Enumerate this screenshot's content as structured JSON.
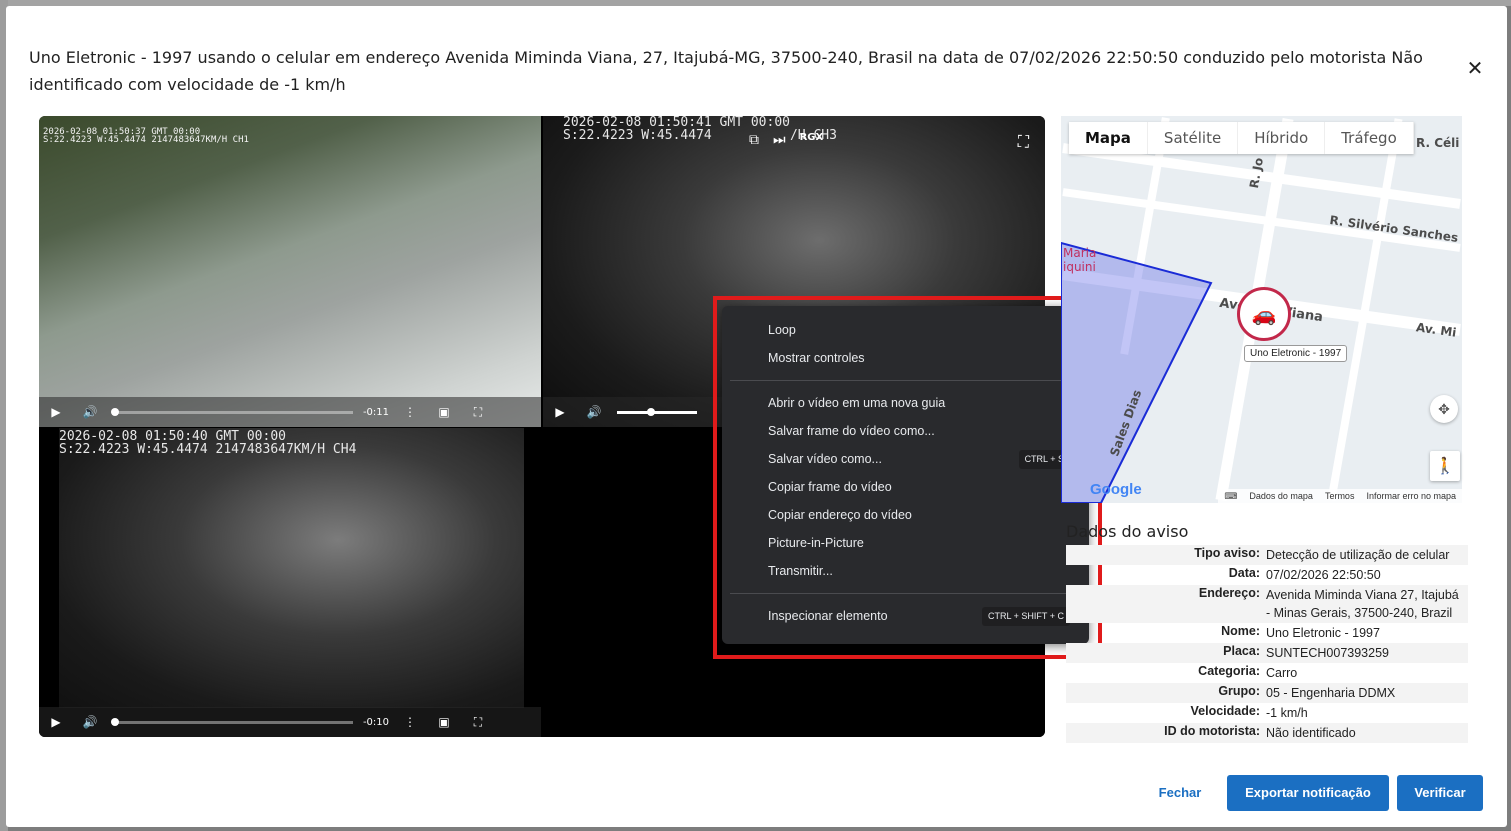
{
  "modal": {
    "title": "Uno Eletronic - 1997 usando o celular em endereço Avenida Miminda Viana, 27, Itajubá-MG, 37500-240, Brasil na data de 07/02/2026 22:50:50 conduzido pelo motorista Não identificado com velocidade de -1 km/h",
    "close": "✕"
  },
  "videos": {
    "cam1": {
      "osd": "2026-02-08 01:50:37 GMT 00:00\nS:22.4223 W:45.4474 2147483647KM/H CH1",
      "time": "-0:11",
      "progress": 0
    },
    "cam2": {
      "osd": "2026-02-08 01:50:41 GMT 00:00\nS:22.4223 W:45.4474          /H CH3",
      "rgx": "RGX",
      "progress": 0.42
    },
    "cam3": {
      "osd": "2026-02-08 01:50:40 GMT 00:00\nS:22.4223 W:45.4474 2147483647KM/H CH4",
      "time": "-0:10",
      "progress": 0
    }
  },
  "context_menu": {
    "items": [
      {
        "label": "Loop"
      },
      {
        "label": "Mostrar controles"
      },
      {
        "label": "Abrir o vídeo em uma nova guia"
      },
      {
        "label": "Salvar frame do vídeo como..."
      },
      {
        "label": "Salvar vídeo como...",
        "shortcut": "CTRL + S"
      },
      {
        "label": "Copiar frame do vídeo"
      },
      {
        "label": "Copiar endereço do vídeo"
      },
      {
        "label": "Picture-in-Picture"
      },
      {
        "label": "Transmitir..."
      },
      {
        "label": "Inspecionar elemento",
        "shortcut": "CTRL + SHIFT + C"
      }
    ]
  },
  "map": {
    "tabs": [
      "Mapa",
      "Satélite",
      "Híbrido",
      "Tráfego"
    ],
    "active_tab": "Mapa",
    "street_labels": [
      "R. Silvério Sanches",
      "Avenida Viana",
      "Av. Mi",
      "R. Jo",
      "Maria",
      "iquini",
      "R. Céli",
      "Sales Dias"
    ],
    "car_label": "Uno Eletronic - 1997",
    "footer": [
      "Dados do mapa",
      "Termos",
      "Informar erro no mapa"
    ],
    "google": "Google",
    "marker_color": "#c2284a"
  },
  "info": {
    "title": "Dados do aviso",
    "rows": [
      {
        "key": "Tipo aviso:",
        "val": "Detecção de utilização de celular"
      },
      {
        "key": "Data:",
        "val": "07/02/2026 22:50:50"
      },
      {
        "key": "Endereço:",
        "val": "Avenida Miminda Viana 27, Itajubá - Minas Gerais, 37500-240, Brazil"
      },
      {
        "key": "Nome:",
        "val": "Uno Eletronic - 1997"
      },
      {
        "key": "Placa:",
        "val": "SUNTECH007393259"
      },
      {
        "key": "Categoria:",
        "val": "Carro"
      },
      {
        "key": "Grupo:",
        "val": "05 - Engenharia DDMX"
      },
      {
        "key": "Velocidade:",
        "val": "-1 km/h"
      },
      {
        "key": "ID do motorista:",
        "val": "Não identificado"
      }
    ]
  },
  "footer": {
    "close": "Fechar",
    "export": "Exportar notificação",
    "verify": "Verificar",
    "primary_color": "#1b6fc2"
  }
}
